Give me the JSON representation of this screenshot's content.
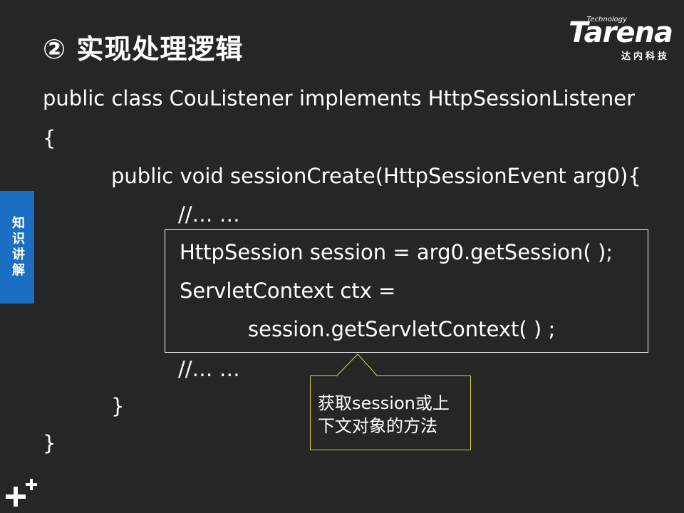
{
  "slide": {
    "title": "② 实现处理逻辑",
    "side_tab": "知识讲解"
  },
  "logo": {
    "technology": "Technology",
    "brand": "Tarena",
    "chinese": "达内科技"
  },
  "code": {
    "line1": "public class  CouListener implements HttpSessionListener",
    "line2": "{",
    "line3": "public void sessionCreate(HttpSessionEvent arg0){",
    "line4": "//… …",
    "line5": "HttpSession  session = arg0.getSession( );",
    "line6": "ServletContext ctx =",
    "line7": "session.getServletContext( ) ;",
    "line8": "//… …",
    "line9": "}",
    "line10": "}"
  },
  "callout": {
    "line1": "获取session或上",
    "line2": "下文对象的方法"
  },
  "colors": {
    "background": "#262626",
    "side_tab": "#1a6fc4",
    "callout_border": "#d6d645",
    "text": "#ffffff"
  }
}
